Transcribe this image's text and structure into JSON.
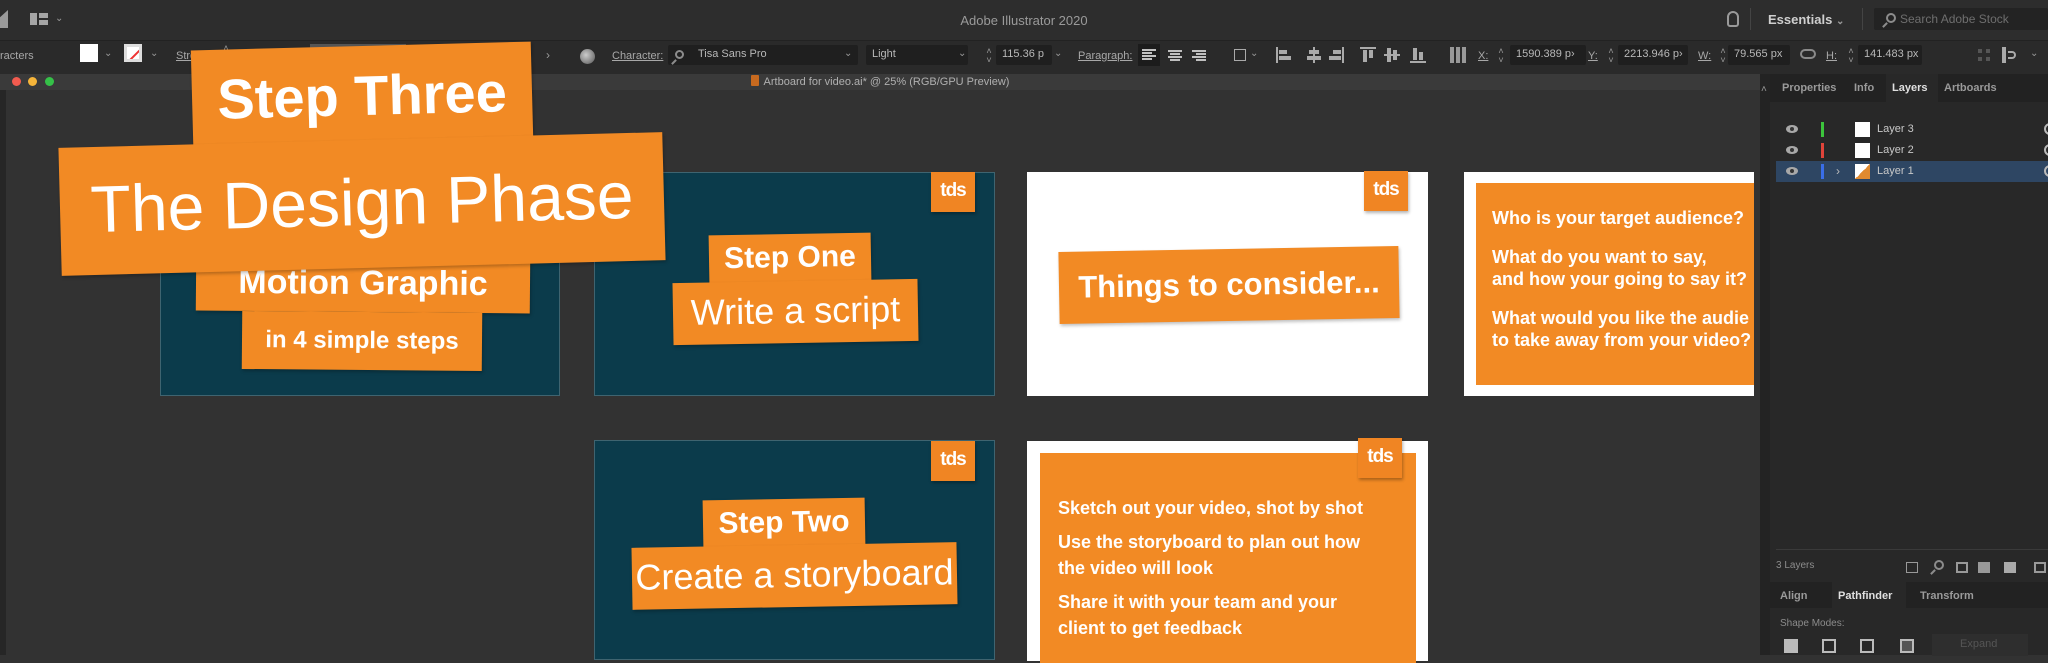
{
  "app": {
    "title": "Adobe Illustrator 2020",
    "workspace": "Essentials",
    "stock_search_placeholder": "Search Adobe Stock"
  },
  "control_bar": {
    "left_label": "racters",
    "stroke_label": "Stroke:",
    "character_label": "Character:",
    "font_family": "Tisa Sans Pro",
    "font_style": "Light",
    "font_size": "115.36 p",
    "paragraph_label": "Paragraph:",
    "x_label": "X:",
    "x_value": "1590.389 p›",
    "y_label": "Y:",
    "y_value": "2213.946 p›",
    "w_label": "W:",
    "w_value": "79.565 px",
    "h_label": "H:",
    "h_value": "141.483 px"
  },
  "document": {
    "tab_title": "Artboard for video.ai* @ 25% (RGB/GPU Preview)"
  },
  "colors": {
    "orange": "#f28a24",
    "artboard_dark": "#0b3b4b",
    "layer3": "#3cc43c",
    "layer2": "#e0443a",
    "layer1": "#3a6ee8",
    "selection": "#2e4663"
  },
  "artboards": {
    "title_card": {
      "line1": "Step Three",
      "line2": "The Design Phase",
      "line3": "Motion Graphic",
      "line4": "in 4 simple steps"
    },
    "step_one": {
      "logo": "tds",
      "title": "Step One",
      "subtitle": "Write a script"
    },
    "consider": {
      "logo": "tds",
      "title": "Things to consider..."
    },
    "questions": {
      "q1": "Who is your target audience?",
      "q2a": "What  do you want to say,",
      "q2b": "and how your going to say it?",
      "q3a": "What would you like the audie",
      "q3b": "to take away from your video?"
    },
    "step_two": {
      "logo": "tds",
      "title": "Step Two",
      "subtitle": "Create a storyboard"
    },
    "storyboard": {
      "logo": "tds",
      "p1": "Sketch out your video, shot by shot",
      "p2a": "Use the storyboard to plan out how",
      "p2b": "the video will look",
      "p3a": "Share it with your team and your",
      "p3b": "client to get feedback"
    }
  },
  "panel": {
    "tabs": [
      "Properties",
      "Info",
      "Layers",
      "Artboards"
    ],
    "active_tab": "Layers",
    "layers": [
      {
        "name": "Layer 3"
      },
      {
        "name": "Layer 2"
      },
      {
        "name": "Layer 1"
      }
    ],
    "layer_count": "3 Layers",
    "bottom_tabs": [
      "Align",
      "Pathfinder",
      "Transform"
    ],
    "bottom_active": "Pathfinder",
    "shape_modes_label": "Shape Modes:",
    "expand_label": "Expand"
  }
}
